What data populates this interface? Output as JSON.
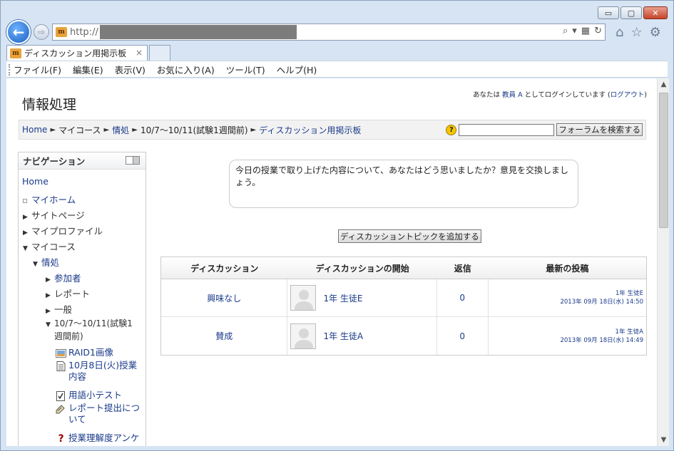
{
  "browser": {
    "url_prefix": "http://",
    "tab_title": "ディスカッション用掲示板",
    "tab_close": "×",
    "window_controls": {
      "minimize": "▭",
      "maximize": "▢",
      "close": "✕"
    },
    "menu": [
      "ファイル(F)",
      "編集(E)",
      "表示(V)",
      "お気に入り(A)",
      "ツール(T)",
      "ヘルプ(H)"
    ]
  },
  "page": {
    "title": "情報処理",
    "login": {
      "prefix": "あなたは ",
      "user": "教員 A",
      "middle": " としてログインしています (",
      "logout": "ログアウト",
      "suffix": ")"
    }
  },
  "breadcrumb": [
    {
      "label": "Home",
      "link": true
    },
    {
      "label": "マイコース",
      "link": false
    },
    {
      "label": "情処",
      "link": true
    },
    {
      "label": "10/7～10/11(試験1週間前)",
      "link": false
    },
    {
      "label": "ディスカッション用掲示板",
      "link": true
    }
  ],
  "breadcrumb_sep": "►",
  "forum_search": {
    "button": "フォーラムを検索する",
    "help": "?"
  },
  "navigation": {
    "title": "ナビゲーション",
    "home": "Home",
    "my_home": "マイホーム",
    "site_pages": "サイトページ",
    "my_profile": "マイプロファイル",
    "my_courses": "マイコース",
    "course": "情処",
    "participants": "参加者",
    "reports": "レポート",
    "general": "一般",
    "week_line1": "10/7～10/11(試験1",
    "week_line2": "週間前)",
    "res1": "RAID1画像",
    "res2_line1": "10月8日(火)授業",
    "res2_line2": "内容",
    "res3": "用語小テスト",
    "res4_line1": "レポート提出につ",
    "res4_line2": "いて",
    "res5": "授業理解度アンケ"
  },
  "forum": {
    "intro_line1": "今日の授業で取り上げた内容について、あなたはどう思いましたか？意見を交換しまし",
    "intro_line2": "ょう。",
    "add_topic": "ディスカッショントピックを追加する",
    "headers": {
      "discussion": "ディスカッション",
      "started_by": "ディスカッションの開始",
      "replies": "返信",
      "last_post": "最新の投稿"
    },
    "rows": [
      {
        "discussion": "興味なし",
        "author": "1年 生徒E",
        "replies": "0",
        "last_author": "1年 生徒E",
        "last_date": "2013年 09月 18日(水) 14:50"
      },
      {
        "discussion": "賛成",
        "author": "1年 生徒A",
        "replies": "0",
        "last_author": "1年 生徒A",
        "last_date": "2013年 09月 18日(水) 14:49"
      }
    ]
  }
}
